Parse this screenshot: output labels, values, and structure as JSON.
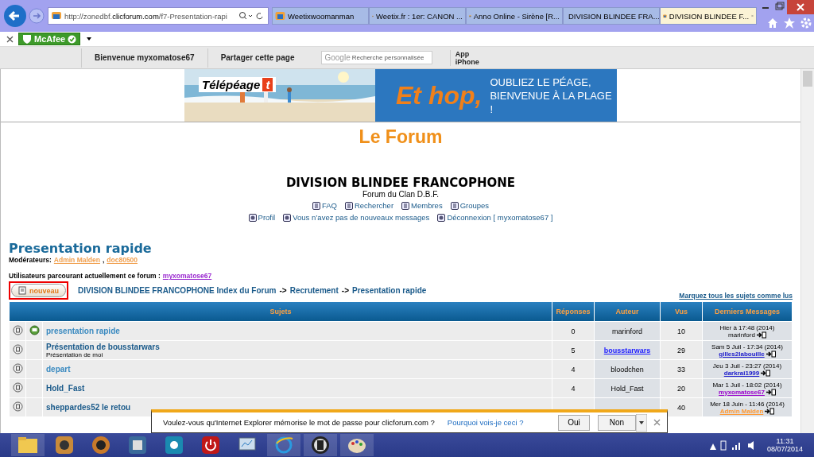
{
  "browser": {
    "url_prefix": "http://zonedbf.",
    "url_domain": "clicforum.com",
    "url_rest": "/f7-Presentation-rapi",
    "tabs": [
      {
        "title": "Weetixwoomanman",
        "selected": false
      },
      {
        "title": "Weetix.fr : 1er: CANON ...",
        "selected": false
      },
      {
        "title": "Anno Online - Sirène [R...",
        "selected": false
      },
      {
        "title": "DIVISION BLINDEE FRA...",
        "selected": false
      },
      {
        "title": "DIVISION BLINDEE F...",
        "selected": true
      }
    ]
  },
  "toolbar": {
    "mcafee": "McAfee"
  },
  "forum_bar": {
    "welcome": "Bienvenue myxomatose67",
    "share": "Partager cette page",
    "search_brand": "Google",
    "search_placeholder": "Recherche personnalisée",
    "app": "App\niPhone"
  },
  "ad": {
    "brand": "Télépéage",
    "brand_mark": "t",
    "headline": "Et hop,",
    "tagline": "OUBLIEZ LE PÉAGE,\nBIENVENUE À LA PLAGE !"
  },
  "forum": {
    "logo": "Le Forum",
    "title": "DIVISION BLINDEE FRANCOPHONE",
    "subtitle": "Forum du Clan D.B.F.",
    "nav": [
      {
        "label": "FAQ"
      },
      {
        "label": "Rechercher"
      },
      {
        "label": "Membres"
      },
      {
        "label": "Groupes"
      }
    ],
    "nav2": [
      {
        "label": "Profil"
      },
      {
        "label": "Vous n’avez pas de nouveaux messages"
      },
      {
        "label": "Déconnexion [ myxomatose67 ]"
      }
    ]
  },
  "section": {
    "title": "Presentation rapide",
    "moderators_label": "Modérateurs:",
    "moderators": [
      "Admin Malden",
      "doc80500"
    ],
    "moderator_separator": ",",
    "viewers_label": "Utilisateurs parcourant actuellement ce forum :",
    "viewers": [
      "myxomatose67"
    ],
    "new_button": "nouveau",
    "breadcrumb": [
      {
        "kind": "link",
        "text": "DIVISION BLINDEE FRANCOPHONE Index du Forum"
      },
      {
        "kind": "sep",
        "text": "->"
      },
      {
        "kind": "link",
        "text": "Recrutement"
      },
      {
        "kind": "sep",
        "text": "->"
      },
      {
        "kind": "link",
        "text": "Presentation rapide"
      }
    ],
    "mark_read": "Marquez tous les sujets comme lus"
  },
  "table": {
    "columns": [
      "Sujets",
      "Réponses",
      "Auteur",
      "Vus",
      "Derniers Messages"
    ],
    "rows": [
      {
        "title": "presentation rapide",
        "visited": true,
        "featured": true,
        "replies": "0",
        "author": "marinford",
        "author_link": false,
        "views": "10",
        "last_date": "Hier à 17:48 (2014)",
        "last_user": "marinford"
      },
      {
        "title": "Présentation de bousstarwars",
        "subtitle": "Présentation de moi",
        "visited": false,
        "featured": false,
        "replies": "5",
        "author": "bousstarwars",
        "author_link": true,
        "views": "29",
        "last_date": "Sam 5 Juil - 17:34 (2014)",
        "last_user": "gilles2labouille",
        "color": "#1a1acc"
      },
      {
        "title": "depart",
        "visited": true,
        "featured": false,
        "replies": "4",
        "author": "bloodchen",
        "author_link": false,
        "views": "33",
        "last_date": "Jeu 3 Juil - 23:27 (2014)",
        "last_user": "darkrai1999",
        "color": "#1a1acc"
      },
      {
        "title": "Hold_Fast",
        "visited": false,
        "featured": false,
        "replies": "4",
        "author": "Hold_Fast",
        "author_link": false,
        "views": "20",
        "last_date": "Mar 1 Juil - 18:02 (2014)",
        "last_user": "myxomatose67",
        "color": "#9900cc"
      },
      {
        "title": "sheppardes52 le retou",
        "visited": false,
        "featured": false,
        "views": "40",
        "last_date": "Mer 18 Juin - 11:46 (2014)",
        "last_user": "Admin Malden",
        "color": "#ff9933"
      }
    ]
  },
  "dialog": {
    "message": "Voulez-vous qu'Internet Explorer mémorise le mot de passe pour clicforum.com ?",
    "link": "Pourquoi vois-je ceci ?",
    "buttons": [
      "Oui",
      "Non"
    ]
  },
  "taskbar": {
    "time": "11:31",
    "date": "08/07/2014"
  }
}
